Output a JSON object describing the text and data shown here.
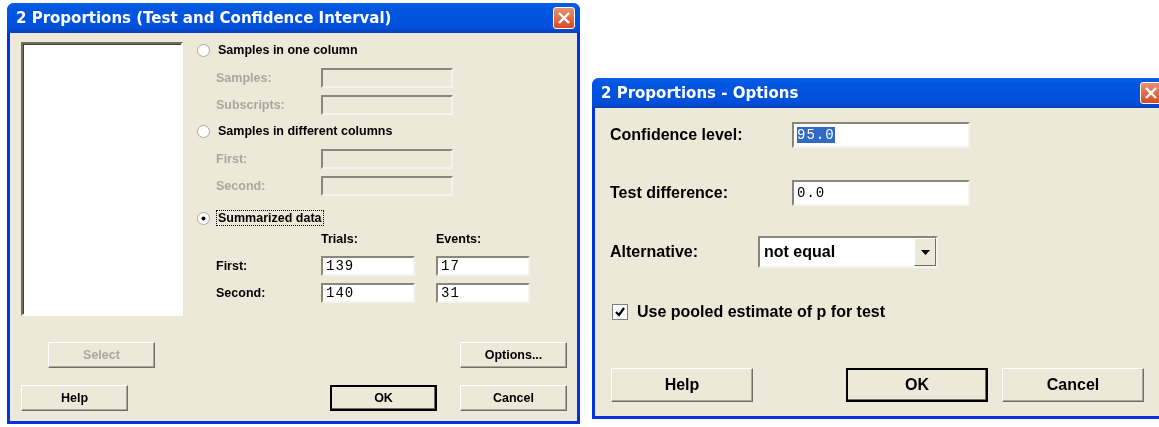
{
  "main_dialog": {
    "title": "2 Proportions (Test and Confidence Interval)",
    "modes": [
      {
        "label": "Samples in one column",
        "selected": false,
        "focused": false,
        "fields": [
          {
            "label": "Samples:",
            "disabled": true
          },
          {
            "label": "Subscripts:",
            "disabled": true
          }
        ]
      },
      {
        "label": "Samples in different columns",
        "selected": false,
        "focused": false,
        "fields": [
          {
            "label": "First:",
            "disabled": true
          },
          {
            "label": "Second:",
            "disabled": true
          }
        ]
      },
      {
        "label": "Summarized data",
        "selected": true,
        "focused": true,
        "columns": [
          "Trials:",
          "Events:"
        ],
        "rows": [
          {
            "label": "First:",
            "values": [
              "139",
              "17"
            ]
          },
          {
            "label": "Second:",
            "values": [
              "140",
              "31"
            ]
          }
        ]
      }
    ],
    "buttons": [
      {
        "label": "Select",
        "disabled": true,
        "default": false
      },
      {
        "label": "Options...",
        "disabled": false,
        "default": false
      },
      {
        "label": "Help",
        "disabled": false,
        "default": false
      },
      {
        "label": "OK",
        "disabled": false,
        "default": true
      },
      {
        "label": "Cancel",
        "disabled": false,
        "default": false
      }
    ]
  },
  "options_dialog": {
    "title": "2 Proportions - Options",
    "fields": [
      {
        "kind": "text",
        "label": "Confidence level:",
        "value": "95.0",
        "text_selected": true
      },
      {
        "kind": "text",
        "label": "Test difference:",
        "value": "0.0",
        "text_selected": false
      },
      {
        "kind": "dropdown",
        "label": "Alternative:",
        "value": "not equal"
      },
      {
        "kind": "checkbox",
        "label": "Use pooled estimate of p for test",
        "checked": true
      }
    ],
    "buttons": [
      {
        "label": "Help",
        "disabled": false,
        "default": false
      },
      {
        "label": "OK",
        "disabled": false,
        "default": true
      },
      {
        "label": "Cancel",
        "disabled": false,
        "default": false
      }
    ]
  }
}
